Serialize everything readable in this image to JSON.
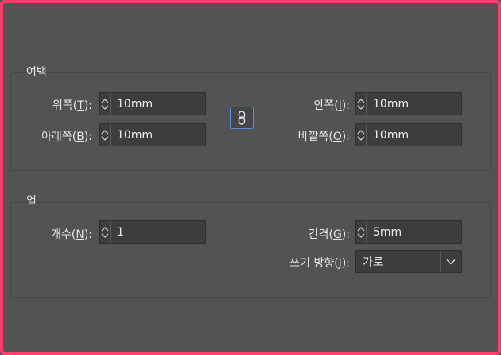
{
  "margins": {
    "title": "여백",
    "top": {
      "label_pre": "위쪽(",
      "mnemonic": "T",
      "label_post": "):",
      "value": "10mm"
    },
    "bottom": {
      "label_pre": "아래쪽(",
      "mnemonic": "B",
      "label_post": "):",
      "value": "10mm"
    },
    "inside": {
      "label_pre": "안쪽(",
      "mnemonic": "I",
      "label_post": "):",
      "value": "10mm"
    },
    "outside": {
      "label_pre": "바깥쪽(",
      "mnemonic": "O",
      "label_post": "):",
      "value": "10mm"
    },
    "link_icon": "chain-link-icon"
  },
  "columns": {
    "title": "열",
    "count": {
      "label_pre": "개수(",
      "mnemonic": "N",
      "label_post": "):",
      "value": "1"
    },
    "gutter": {
      "label_pre": "간격(",
      "mnemonic": "G",
      "label_post": "):",
      "value": "5mm"
    },
    "direction": {
      "label_pre": "쓰기 방향(",
      "mnemonic": "J",
      "label_post": "):",
      "value": "가로"
    }
  },
  "colors": {
    "background": "#535353",
    "field": "#3d3d3d",
    "accent": "#5d8fd6",
    "frame": "#ff3d6e"
  }
}
